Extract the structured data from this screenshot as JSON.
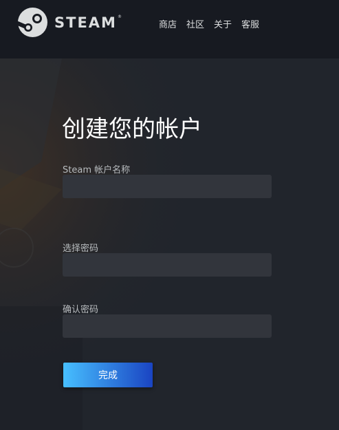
{
  "brand": {
    "name": "STEAM",
    "registered_mark": "®",
    "logo_icon": "steam-logo-icon"
  },
  "nav": {
    "items": [
      {
        "label": "商店"
      },
      {
        "label": "社区"
      },
      {
        "label": "关于"
      },
      {
        "label": "客服"
      }
    ]
  },
  "form": {
    "title": "创建您的帐户",
    "account_name": {
      "label": "Steam 帐户名称",
      "value": ""
    },
    "password": {
      "label": "选择密码",
      "value": ""
    },
    "confirm_password": {
      "label": "确认密码",
      "value": ""
    },
    "submit_label": "完成"
  },
  "colors": {
    "header_bg": "#171a21",
    "content_bg": "#21252c",
    "input_bg": "#32353c",
    "button_gradient_start": "#47bfff",
    "button_gradient_end": "#1a44c2"
  }
}
